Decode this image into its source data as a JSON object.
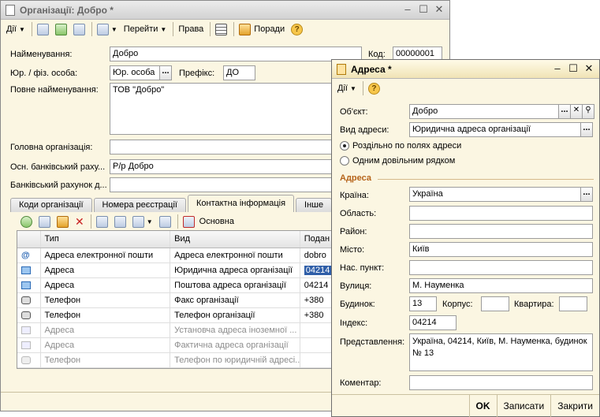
{
  "main_window": {
    "title": "Організації: Добро *",
    "toolbar": {
      "actions": "Дії",
      "goto": "Перейти",
      "rights": "Права",
      "tips": "Поради"
    },
    "fields": {
      "name_label": "Найменування:",
      "name_value": "Добро",
      "code_label": "Код:",
      "code_value": "00000001",
      "type_label": "Юр. / фіз. особа:",
      "type_value": "Юр. особа",
      "prefix_label": "Префікс:",
      "prefix_value": "ДО",
      "fullname_label": "Повне найменування:",
      "fullname_value": "ТОВ \"Добро\"",
      "head_org_label": "Головна організація:",
      "head_org_value": "",
      "bank_label": "Осн. банківський раху...",
      "bank_value": "Р/р Добро",
      "bank2_label": "Банківський рахунок д...",
      "bank2_value": ""
    },
    "tabs": [
      {
        "label": "Коди організації"
      },
      {
        "label": "Номера реєстрації"
      },
      {
        "label": "Контактна інформація"
      },
      {
        "label": "Інше"
      }
    ],
    "grid_toolbar": {
      "main_label": "Основна"
    },
    "grid": {
      "columns": [
        "Тип",
        "Вид",
        "Подан"
      ],
      "rows": [
        {
          "type": "Адреса електронної пошти",
          "kind": "Адреса електронної пошти",
          "value": "dobro",
          "dim": false,
          "icon": "email-icon"
        },
        {
          "type": "Адреса",
          "kind": "Юридична адреса організації",
          "value": "04214",
          "dim": false,
          "icon": "address-icon",
          "selected": true
        },
        {
          "type": "Адреса",
          "kind": "Поштова адреса організації",
          "value": "04214",
          "dim": false,
          "icon": "address-icon"
        },
        {
          "type": "Телефон",
          "kind": "Факс організації",
          "value": "+380",
          "dim": false,
          "icon": "phone-icon"
        },
        {
          "type": "Телефон",
          "kind": "Телефон організації",
          "value": "+380",
          "dim": false,
          "icon": "phone-icon"
        },
        {
          "type": "Адреса",
          "kind": "Установча адреса іноземної ...",
          "value": "",
          "dim": true,
          "icon": "address-icon"
        },
        {
          "type": "Адреса",
          "kind": "Фактична адреса організації",
          "value": "",
          "dim": true,
          "icon": "address-icon"
        },
        {
          "type": "Телефон",
          "kind": "Телефон по юридичній адресі...",
          "value": "",
          "dim": true,
          "icon": "phone-icon"
        }
      ]
    }
  },
  "address_dialog": {
    "title": "Адреса *",
    "toolbar": {
      "actions": "Дії"
    },
    "object_label": "Об'єкт:",
    "object_value": "Добро",
    "address_kind_label": "Вид адреси:",
    "address_kind_value": "Юридична адреса організації",
    "radio_fields": "Роздільно по полях адреси",
    "radio_line": "Одним довільним рядком",
    "section_title": "Адреса",
    "country_label": "Країна:",
    "country_value": "Україна",
    "region_label": "Область:",
    "region_value": "",
    "district_label": "Район:",
    "district_value": "",
    "city_label": "Місто:",
    "city_value": "Київ",
    "locality_label": "Нас. пункт:",
    "locality_value": "",
    "street_label": "Вулиця:",
    "street_value": "М. Науменка",
    "house_label": "Будинок:",
    "house_value": "13",
    "block_label": "Корпус:",
    "block_value": "",
    "apartment_label": "Квартира:",
    "apartment_value": "",
    "index_label": "Індекс:",
    "index_value": "04214",
    "presentation_label": "Представлення:",
    "presentation_value": "Україна, 04214, Київ, М. Науменка, будинок № 13",
    "comment_label": "Коментар:",
    "comment_value": "",
    "buttons": {
      "ok": "OK",
      "save": "Записати",
      "close": "Закрити"
    }
  }
}
